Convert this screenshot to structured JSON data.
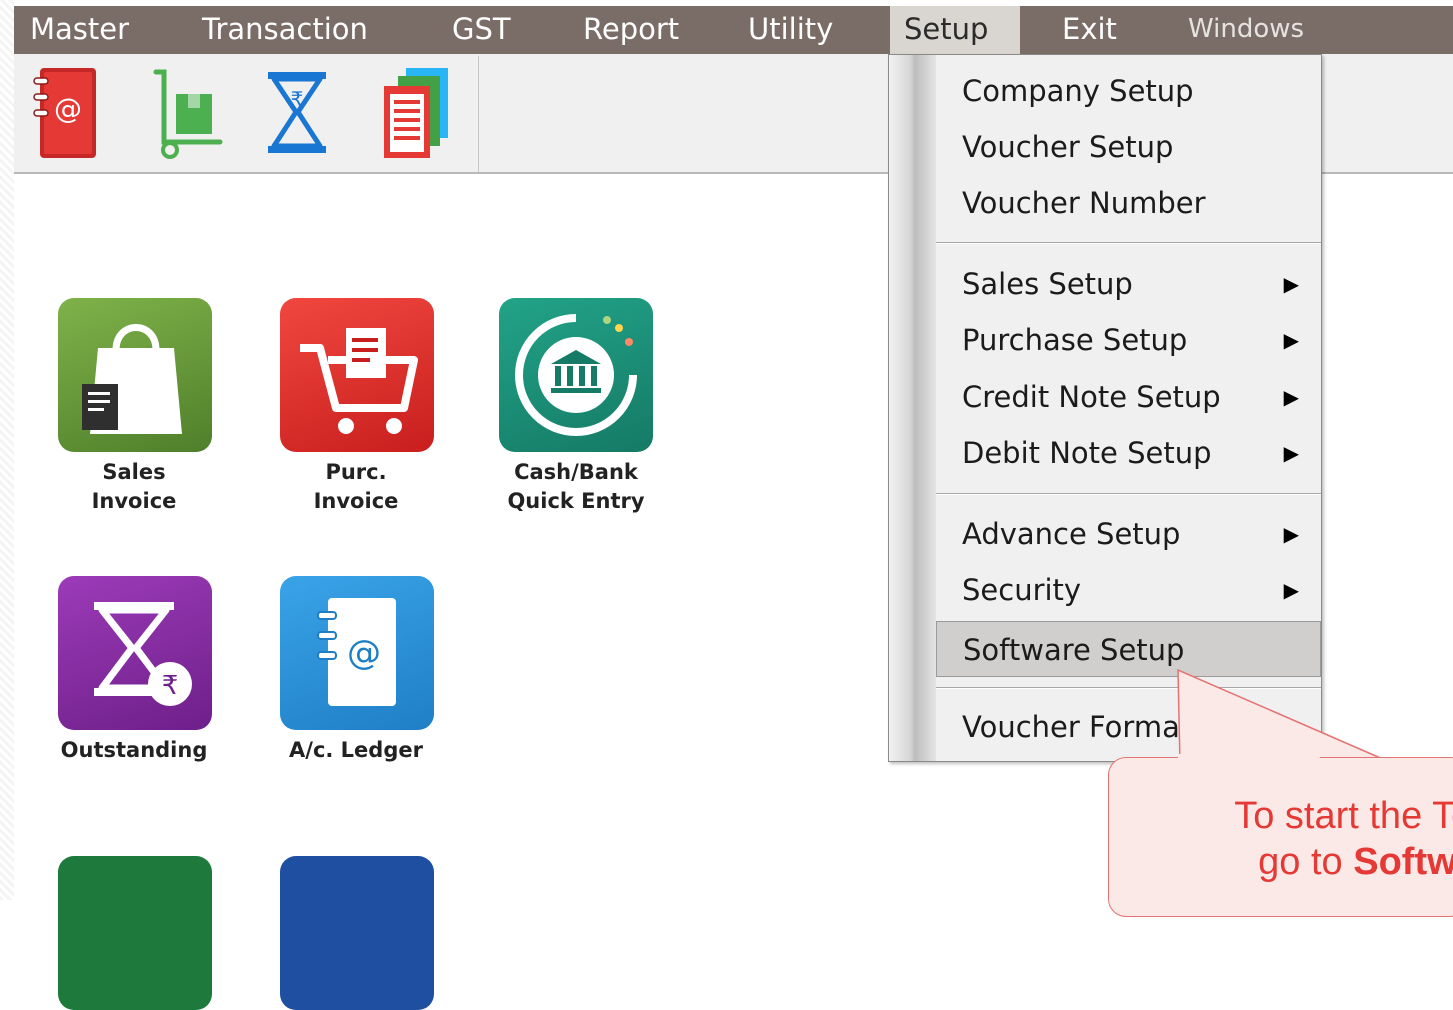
{
  "menubar": {
    "items": [
      {
        "label": "Master"
      },
      {
        "label": "Transaction"
      },
      {
        "label": "GST"
      },
      {
        "label": "Report"
      },
      {
        "label": "Utility"
      },
      {
        "label": "Setup"
      },
      {
        "label": "Exit"
      },
      {
        "label": "Windows"
      }
    ],
    "active": "Setup"
  },
  "toolbar": {
    "icons": [
      "address-book-icon",
      "hand-truck-icon",
      "hourglass-rupee-icon",
      "documents-icon"
    ]
  },
  "desktop": {
    "tiles": [
      {
        "label_line1": "Sales",
        "label_line2": "Invoice",
        "icon": "shopping-bag-icon",
        "color": "#6a9a3f"
      },
      {
        "label_line1": "Purc.",
        "label_line2": "Invoice",
        "icon": "shopping-cart-icon",
        "color": "#e23a3a"
      },
      {
        "label_line1": "Cash/Bank",
        "label_line2": "Quick Entry",
        "icon": "bank-icon",
        "color": "#1f8f7a"
      },
      {
        "label_line1": "Outstanding",
        "label_line2": "",
        "icon": "hourglass-rupee-icon",
        "color": "#8a2ea3"
      },
      {
        "label_line1": "A/c. Ledger",
        "label_line2": "",
        "icon": "address-book-icon",
        "color": "#2a8fd6"
      }
    ]
  },
  "setup_menu": {
    "items": [
      {
        "label": "Company Setup",
        "submenu": false
      },
      {
        "label": "Voucher Setup",
        "submenu": false
      },
      {
        "label": "Voucher Number",
        "submenu": false
      },
      {
        "label": "Sales Setup",
        "submenu": true
      },
      {
        "label": "Purchase Setup",
        "submenu": true
      },
      {
        "label": "Credit Note Setup",
        "submenu": true
      },
      {
        "label": "Debit Note Setup",
        "submenu": true
      },
      {
        "label": "Advance Setup",
        "submenu": true
      },
      {
        "label": "Security",
        "submenu": true
      },
      {
        "label": "Software Setup",
        "submenu": false
      },
      {
        "label": "Voucher Format",
        "submenu": false
      }
    ],
    "highlighted": "Software Setup",
    "submenu_glyph": "▶"
  },
  "callout": {
    "line1": "To start the Tele",
    "line2_prefix": "go to ",
    "line2_bold": "Softwa"
  },
  "colors": {
    "menubar_bg": "#7a6d67",
    "callout_text": "#e53935",
    "callout_bg": "#fbe9e7"
  }
}
